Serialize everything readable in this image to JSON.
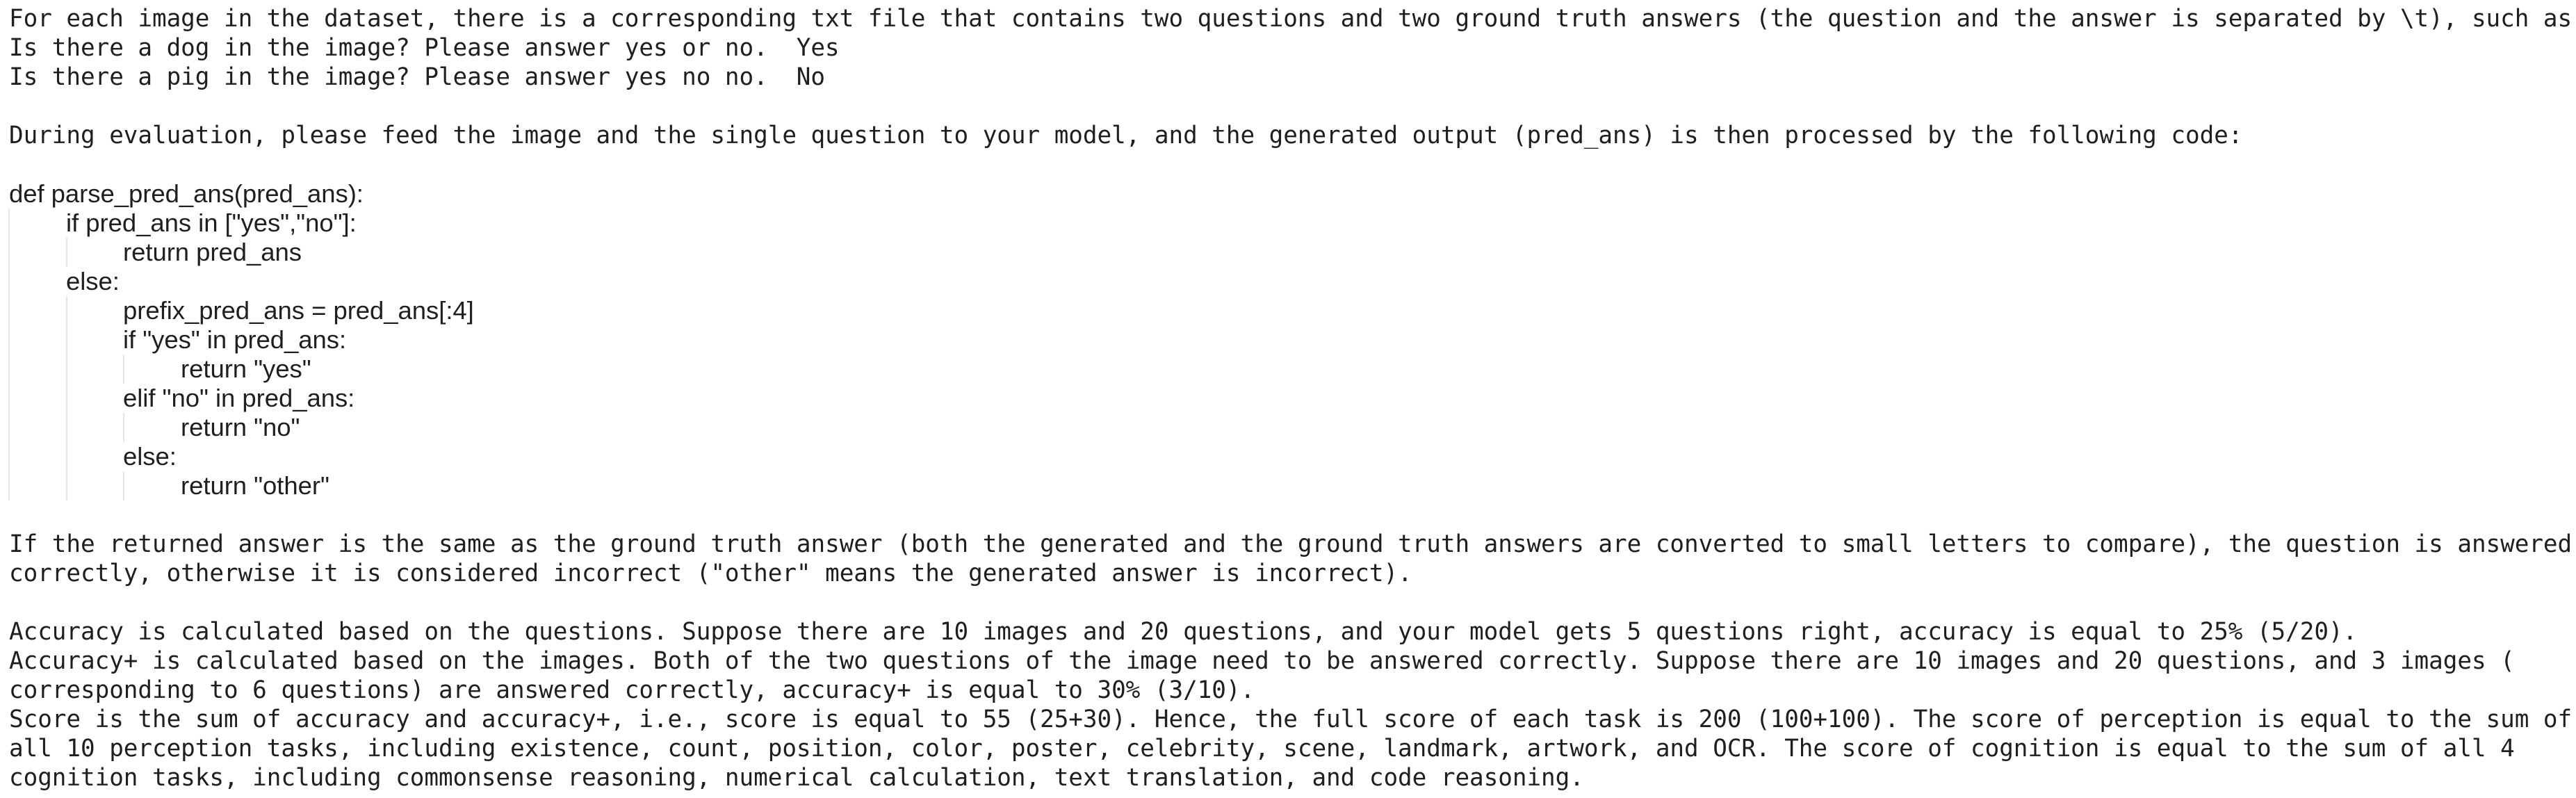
{
  "intro": {
    "line1": "For each image in the dataset, there is a corresponding txt file that contains two questions and two ground truth answers (the question and the answer is separated by \\t), such as:",
    "example1_question": "Is there a dog in the image? Please answer yes or no.",
    "example1_answer": "Yes",
    "example2_question": "Is there a pig in the image? Please answer yes no no.",
    "example2_answer": "No"
  },
  "evaluation": {
    "line": "During evaluation, please feed the image and the single question to your model, and the generated output (pred_ans) is then processed by the following code:"
  },
  "code": {
    "lines": [
      "def parse_pred_ans(pred_ans):",
      "if pred_ans in [\"yes\",\"no\"]:",
      "return pred_ans",
      "else:",
      "prefix_pred_ans = pred_ans[:4]",
      "if \"yes\" in pred_ans:",
      "return \"yes\"",
      "elif \"no\" in pred_ans:",
      "return \"no\"",
      "else:",
      "return \"other\""
    ]
  },
  "correctness": {
    "line1": "If the returned answer is the same as the ground truth answer (both the generated and the ground truth answers are converted to small letters to compare), the question is answered",
    "line2": "correctly, otherwise it is considered incorrect (\"other\" means the generated answer is incorrect)."
  },
  "metrics": {
    "accuracy": "Accuracy is calculated based on the questions. Suppose there are 10 images and 20 questions, and your model gets 5 questions right, accuracy is equal to 25% (5/20).",
    "accuracy_plus_1": "Accuracy+ is calculated based on the images. Both of the two questions of the image need to be answered correctly. Suppose there are 10 images and 20 questions, and 3 images (",
    "accuracy_plus_2": "corresponding to 6 questions) are answered correctly, accuracy+ is equal to 30% (3/10).",
    "score_1": "Score is the sum of accuracy and accuracy+, i.e., score is equal to 55 (25+30). Hence, the full score of each task is 200 (100+100). The score of perception is equal to the sum of",
    "score_2": "all 10 perception tasks, including existence, count, position, color, poster, celebrity, scene, landmark, artwork, and OCR. The score of cognition is equal to the sum of all 4",
    "score_3": "cognition tasks, including commonsense reasoning, numerical calculation, text translation, and code reasoning."
  }
}
